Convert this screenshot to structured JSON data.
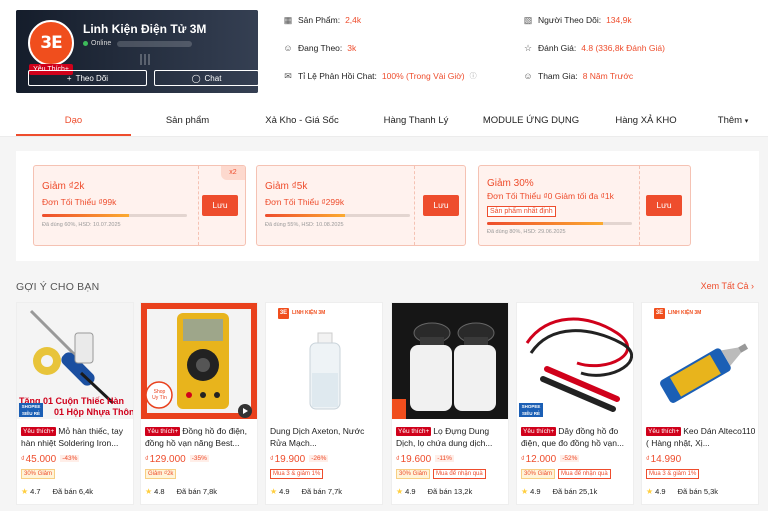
{
  "shop": {
    "name": "Linh Kiện Điện Tử 3M",
    "online_label": "Online",
    "logo_text": "3E",
    "preferred_badge": "Yêu Thích+",
    "follow_label": "Theo Dõi",
    "chat_label": "Chat"
  },
  "stats": [
    {
      "icon": "store-icon",
      "label": "Sản Phẩm:",
      "value": "2,4k"
    },
    {
      "icon": "followers-icon",
      "label": "Người Theo Dõi:",
      "value": "134,9k"
    },
    {
      "icon": "following-icon",
      "label": "Đang Theo:",
      "value": "3k"
    },
    {
      "icon": "star-outline-icon",
      "label": "Đánh Giá:",
      "value": "4.8 (336,8k Đánh Giá)"
    },
    {
      "icon": "chat-response-icon",
      "label": "Tỉ Lệ Phản Hồi Chat:",
      "value": "100% (Trong Vài Giờ)"
    },
    {
      "icon": "join-date-icon",
      "label": "Tham Gia:",
      "value": "8 Năm Trước"
    }
  ],
  "tabs": [
    "Dạo",
    "Sản phẩm",
    "Xả Kho - Giá Sốc",
    "Hàng Thanh Lý",
    "MODULE ỨNG DỤNG",
    "Hàng XẢ KHO",
    "Thêm"
  ],
  "vouchers": [
    {
      "title": "Giảm ₫2k",
      "condition": "Đơn Tối Thiểu ₫99k",
      "meta": "Đã dùng 60%, HSD: 10.07.2025",
      "used": 0.6,
      "save": "Lưu",
      "multiplier": "x2",
      "tag": ""
    },
    {
      "title": "Giảm ₫5k",
      "condition": "Đơn Tối Thiểu ₫299k",
      "meta": "Đã dùng 55%, HSD: 10.08.2025",
      "used": 0.55,
      "save": "Lưu",
      "multiplier": "",
      "tag": ""
    },
    {
      "title": "Giảm 30%",
      "condition": "Đơn Tối Thiểu ₫0 Giảm tối đa ₫1k",
      "meta": "Đã dùng 80%, HSD: 29.06.2025",
      "used": 0.8,
      "save": "Lưu",
      "multiplier": "",
      "tag": "Sản phẩm nhất định"
    }
  ],
  "recommend": {
    "title": "GỢI Ý CHO BẠN",
    "see_all": "Xem Tất Cả"
  },
  "products": [
    {
      "name": "Mỏ hàn thiếc, tay hàn nhiệt Soldering Iron...",
      "price": "45.000",
      "discount": "-43%",
      "tags": [
        "30% Giảm"
      ],
      "rating": "4.7",
      "sold": "Đã bán 6,4k",
      "promo1": "Tặng 01 Cuộn Thiếc Hàn",
      "promo2": "01 Hộp Nhựa Thông"
    },
    {
      "name": "Đồng hồ đo điện, đồng hồ vạn năng Best...",
      "price": "129.000",
      "discount": "-35%",
      "tags": [
        "Giảm ₫2k"
      ],
      "rating": "4.8",
      "sold": "Đã bán 7,8k",
      "stamp": "Shop Uy Tín"
    },
    {
      "name": "Dung Dịch Axeton, Nước Rửa Mạch...",
      "price": "19.900",
      "discount": "-26%",
      "tags": [
        "Mua 3 & giảm 1%"
      ],
      "rating": "4.9",
      "sold": "Đã bán 7,7k",
      "brand": "LINH KIỆN 3M"
    },
    {
      "name": "Lọ Đựng Dung Dịch, lọ chứa dung dịch...",
      "price": "19.600",
      "discount": "-11%",
      "tags": [
        "30% Giảm",
        "Mua để nhận quà"
      ],
      "rating": "4.9",
      "sold": "Đã bán 13,2k"
    },
    {
      "name": "Dây đồng hồ đo điện, que đo đồng hồ vạn...",
      "price": "12.000",
      "discount": "-52%",
      "tags": [
        "30% Giảm",
        "Mua để nhận quà"
      ],
      "rating": "4.9",
      "sold": "Đã bán 25,1k"
    },
    {
      "name": "Keo Dán Alteco110 ( Hàng nhật, Xị...",
      "price": "14.990",
      "discount": "",
      "tags": [
        "Mua 3 & giảm 1%"
      ],
      "rating": "4.9",
      "sold": "Đã bán 5,3k",
      "brand": "LINH KIỆN 3M"
    }
  ],
  "labels": {
    "preferred": "Yêu thích+",
    "currency": "₫",
    "mall": "SHOPEE SIÊU RẺ"
  },
  "colors": {
    "accent": "#ee4d2d",
    "preferred": "#d0011b",
    "shop_card": "#1f2b3b"
  }
}
